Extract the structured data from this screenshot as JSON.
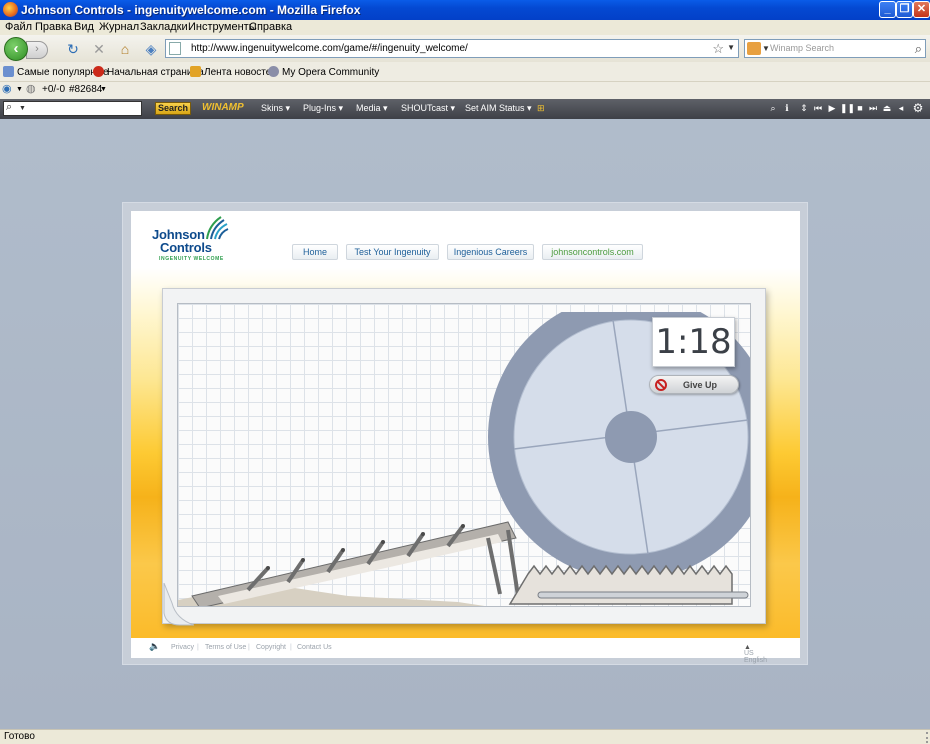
{
  "window": {
    "title": "Johnson Controls - ingenuitywelcome.com - Mozilla Firefox"
  },
  "menu": [
    "Файл",
    "Правка",
    "Вид",
    "Журнал",
    "Закладки",
    "Инструменты",
    "Справка"
  ],
  "nav": {
    "url": "http://www.ingenuitywelcome.com/game/#/ingenuity_welcome/",
    "search_placeholder": "Winamp Search"
  },
  "bookmarks": [
    {
      "label": "Самые популярные",
      "icon": "page-icon",
      "color": "#6b8fcf"
    },
    {
      "label": "Начальная страница",
      "icon": "opera-icon",
      "color": "#cc2a1a"
    },
    {
      "label": "Лента новостей",
      "icon": "rss-folder-icon",
      "color": "#e2a326"
    },
    {
      "label": "My Opera Community",
      "icon": "opera-community-icon",
      "color": "#8a8ea8"
    }
  ],
  "smallbar": {
    "score": "+0/-0",
    "rank": "#82684"
  },
  "winamp": {
    "search_button": "Search",
    "logo": "WINAMP",
    "menus": [
      "Skins",
      "Plug-Ins",
      "Media",
      "SHOUTcast",
      "Set AIM Status"
    ]
  },
  "site": {
    "logo_line1": "Johnson",
    "logo_line2": "Controls",
    "logo_tagline": "INGENUITY WELCOME",
    "tabs": [
      "Home",
      "Test Your Ingenuity",
      "Ingenious Careers",
      "johnsoncontrols.com"
    ],
    "timer": "1:18",
    "give_up": "Give Up",
    "footer_links": [
      "Privacy",
      "Terms of Use",
      "Copyright",
      "Contact Us"
    ],
    "language": "US English"
  },
  "colors": {
    "accent_blue": "#1d5f99",
    "brand_green": "#4b9b3e",
    "wheel": "#8e9ab1",
    "wheel_inner": "#d5ddea",
    "yellow": "#fdca33"
  },
  "status": {
    "text": "Готово"
  }
}
